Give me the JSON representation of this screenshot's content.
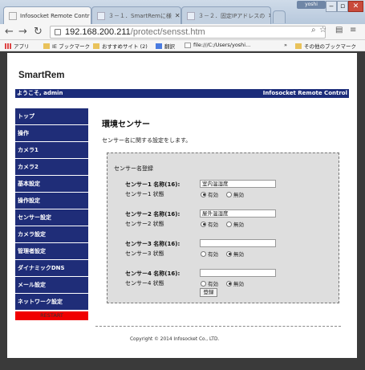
{
  "browser": {
    "tabs": [
      {
        "label": "Infosocket Remote Contr"
      },
      {
        "label": "３－１．SmartRemに様"
      },
      {
        "label": "３－２．固定IPアドレスの"
      }
    ],
    "user_badge": "yoshi",
    "address_host": "192.168.200.211",
    "address_path": "/protect/sensst.htm",
    "bookmarks": [
      {
        "label": "アプリ"
      },
      {
        "label": "IE ブックマーク"
      },
      {
        "label": "おすすめサイト (2)"
      },
      {
        "label": "翻訳"
      },
      {
        "label": "file:///C:/Users/yoshi..."
      },
      {
        "label": "»"
      },
      {
        "label": "その他のブックマーク"
      }
    ]
  },
  "header": {
    "logo": "SmartRem",
    "welcome": "ようこそ, admin",
    "product": "Infosocket Remote Control"
  },
  "sidebar": {
    "items": [
      {
        "label": "トップ"
      },
      {
        "label": "操作"
      },
      {
        "label": "カメラ1"
      },
      {
        "label": "カメラ2"
      },
      {
        "label": "基本設定"
      },
      {
        "label": "操作設定"
      },
      {
        "label": "センサー設定"
      },
      {
        "label": "カメラ設定"
      },
      {
        "label": "管理者設定"
      },
      {
        "label": "ダイナミックDNS"
      },
      {
        "label": "メール設定"
      },
      {
        "label": "ネットワーク設定"
      }
    ],
    "restart": "RESTART"
  },
  "main": {
    "title": "環境センサー",
    "description": "センサー名に関する設定をします。",
    "panel_title": "センサー名登録",
    "enabled_label": "有効",
    "disabled_label": "無効",
    "submit": "登録",
    "sensors": [
      {
        "name_label": "センサー1 名称(16):",
        "state_label": "センサー1 状態",
        "value": "室内温湿度",
        "state": "enabled"
      },
      {
        "name_label": "センサー2 名称(16):",
        "state_label": "センサー2 状態",
        "value": "屋外温湿度",
        "state": "enabled"
      },
      {
        "name_label": "センサー3 名称(16):",
        "state_label": "センサー3 状態",
        "value": "",
        "state": "disabled"
      },
      {
        "name_label": "センサー4 名称(16):",
        "state_label": "センサー4 状態",
        "value": "",
        "state": "disabled"
      }
    ]
  },
  "footer": {
    "copyright": "Copyright © 2014 Infosocket Co., LTD."
  },
  "colors": {
    "nav_blue": "#1f2d78",
    "restart_red": "#f00000"
  }
}
